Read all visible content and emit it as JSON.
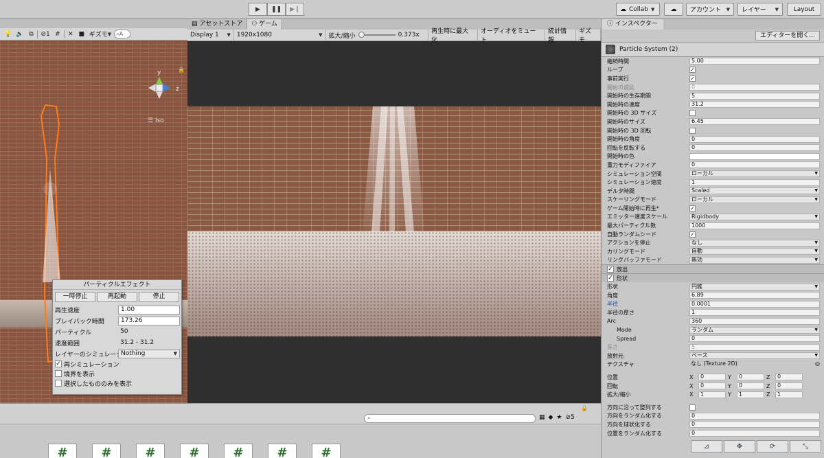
{
  "toolbar": {
    "collab": "Collab",
    "account": "アカウント",
    "layers": "レイヤー",
    "layout": "Layout"
  },
  "scene": {
    "gizmos": "ギズモ",
    "search_placeholder": "A",
    "visibility_count": "1",
    "iso": "Iso",
    "axis_x": "x",
    "axis_y": "y",
    "axis_z": "z"
  },
  "particle_effect": {
    "title": "パーティクルエフェクト",
    "pause": "一時停止",
    "restart": "再起動",
    "stop": "停止",
    "speed_label": "再生速度",
    "speed_value": "1.00",
    "playback_label": "プレイバック時間",
    "playback_value": "173.26",
    "particles_label": "パーティクル",
    "particles_value": "50",
    "speed_range_label": "速度範囲",
    "speed_range_value": "31.2 - 31.2",
    "layer_sim_label": "レイヤーのシミュレーション",
    "layer_sim_value": "Nothing",
    "resim": "再シミュレーション",
    "show_bounds": "境界を表示",
    "show_selected": "選択したもののみを表示"
  },
  "game": {
    "tab_asset_store": "アセットストア",
    "tab_game": "ゲーム",
    "display": "Display 1",
    "resolution": "1920x1080",
    "scale_label": "拡大/縮小",
    "scale_value": "0.373x",
    "maximize": "再生時に最大化",
    "mute": "オーディオをミュート",
    "stats": "統計情報",
    "gizmos": "ギズモ"
  },
  "inspector": {
    "tab": "インスペクター",
    "open_editor": "エディターを開く...",
    "component": "Particle System (2)",
    "main_rows": [
      {
        "label": "継続時間",
        "value": "5.00",
        "kind": "field"
      },
      {
        "label": "ループ",
        "value": "✓",
        "kind": "check"
      },
      {
        "label": "事前実行",
        "value": "✓",
        "kind": "check"
      },
      {
        "label": "開始の遅延",
        "value": "0",
        "kind": "field",
        "dim": true
      },
      {
        "label": "開始時の生存期間",
        "value": "5",
        "kind": "field"
      },
      {
        "label": "開始時の速度",
        "value": "31.2",
        "kind": "field"
      },
      {
        "label": "開始時の 3D サイズ",
        "value": "",
        "kind": "check"
      },
      {
        "label": "開始時のサイズ",
        "value": "6.45",
        "kind": "field"
      },
      {
        "label": "開始時の 3D 回転",
        "value": "",
        "kind": "check"
      },
      {
        "label": "開始時の角度",
        "value": "0",
        "kind": "field"
      },
      {
        "label": "回転を反転する",
        "value": "0",
        "kind": "field"
      },
      {
        "label": "開始時の色",
        "value": "",
        "kind": "color"
      },
      {
        "label": "重力モディファイア",
        "value": "0",
        "kind": "field"
      },
      {
        "label": "シミュレーション空間",
        "value": "ローカル",
        "kind": "dropdown"
      },
      {
        "label": "シミュレーション速度",
        "value": "1",
        "kind": "field"
      },
      {
        "label": "デルタ時間",
        "value": "Scaled",
        "kind": "dropdown"
      },
      {
        "label": "スケーリングモード",
        "value": "ローカル",
        "kind": "dropdown"
      },
      {
        "label": "ゲーム開始時に再生*",
        "value": "✓",
        "kind": "check"
      },
      {
        "label": "エミッター速度スケール",
        "value": "Rigidbody",
        "kind": "dropdown"
      },
      {
        "label": "最大パーティクル数",
        "value": "1000",
        "kind": "field"
      },
      {
        "label": "自動ランダムシード",
        "value": "✓",
        "kind": "check"
      },
      {
        "label": "アクションを停止",
        "value": "なし",
        "kind": "dropdown"
      },
      {
        "label": "カリングモード",
        "value": "自動",
        "kind": "dropdown"
      },
      {
        "label": "リングバッファモード",
        "value": "無効",
        "kind": "dropdown"
      }
    ],
    "section_emission": "放出",
    "section_shape": "形状",
    "shape_rows": [
      {
        "label": "形状",
        "value": "円錐",
        "kind": "dropdown"
      },
      {
        "label": "角度",
        "value": "6.89",
        "kind": "field"
      },
      {
        "label": "半径",
        "value": "0.0001",
        "kind": "field",
        "blue": true
      },
      {
        "label": "半径の厚さ",
        "value": "1",
        "kind": "field"
      },
      {
        "label": "Arc",
        "value": "360",
        "kind": "field"
      },
      {
        "label": "Mode",
        "value": "ランダム",
        "kind": "dropdown",
        "indent": true
      },
      {
        "label": "Spread",
        "value": "0",
        "kind": "field",
        "indent": true
      },
      {
        "label": "長さ",
        "value": "5",
        "kind": "field",
        "dim": true
      },
      {
        "label": "放射元",
        "value": "ベース",
        "kind": "dropdown"
      },
      {
        "label": "テクスチャ",
        "value": "なし (Texture 2D)",
        "kind": "plain"
      }
    ],
    "transform_rows": [
      {
        "label": "位置",
        "x": "0",
        "y": "0",
        "z": "0"
      },
      {
        "label": "回転",
        "x": "0",
        "y": "0",
        "z": "0"
      },
      {
        "label": "拡大/縮小",
        "x": "1",
        "y": "1",
        "z": "1"
      }
    ],
    "tail_rows": [
      {
        "label": "方向に沿って整列する",
        "value": "",
        "kind": "check"
      },
      {
        "label": "方向をランダム化する",
        "value": "0",
        "kind": "field"
      },
      {
        "label": "方向を球状化する",
        "value": "0",
        "kind": "field"
      },
      {
        "label": "位置をランダム化する",
        "value": "0",
        "kind": "field"
      }
    ],
    "axis_x": "X",
    "axis_y": "Y",
    "axis_z": "Z"
  },
  "project": {
    "search_placeholder": "",
    "hidden_count": "5",
    "assets": [
      "#",
      "#",
      "#",
      "#",
      "#",
      "#",
      "#"
    ]
  },
  "colors": {
    "accent_orange": "#ff7a1a",
    "wall": "#8a5a43"
  }
}
